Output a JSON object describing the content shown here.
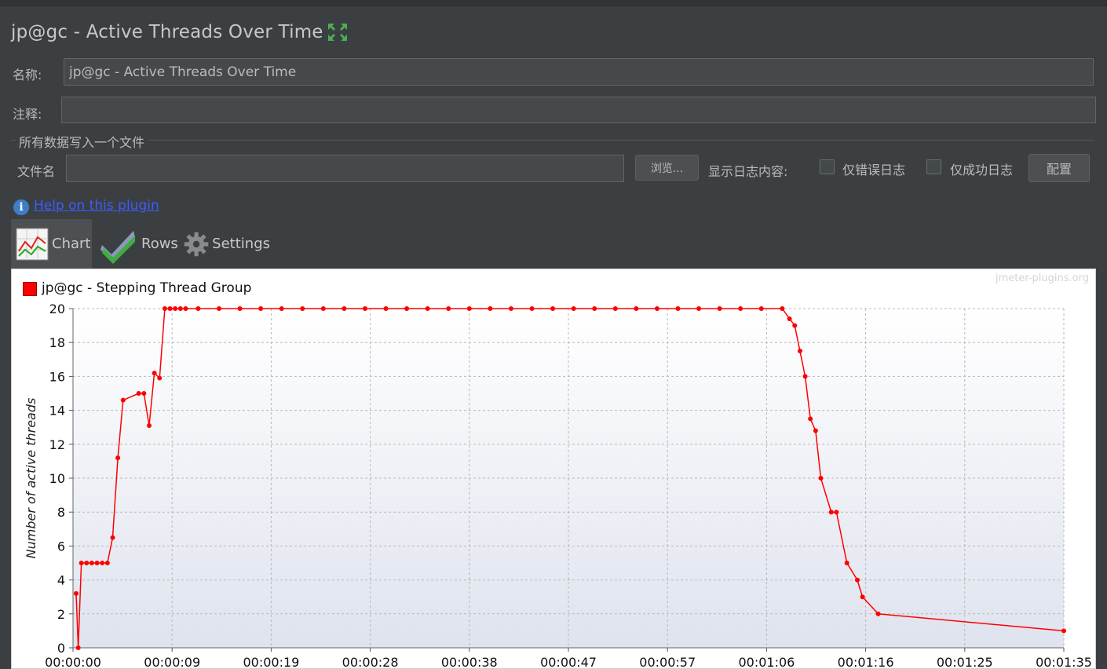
{
  "window": {
    "title": "jp@gc - Active Threads Over Time"
  },
  "form": {
    "name_label": "名称:",
    "name_value": "jp@gc - Active Threads Over Time",
    "comment_label": "注释:",
    "comment_value": "",
    "group_title": "所有数据写入一个文件",
    "filename_label": "文件名",
    "filename_value": "",
    "browse_label": "浏览...",
    "log_display_label": "显示日志内容:",
    "errors_only_label": "仅错误日志",
    "success_only_label": "仅成功日志",
    "configure_label": "配置"
  },
  "help": {
    "link_text": "Help on this plugin"
  },
  "tabs": [
    {
      "label": "Chart",
      "icon": "chart-icon",
      "active": true
    },
    {
      "label": "Rows",
      "icon": "checkmark-icon",
      "active": false
    },
    {
      "label": "Settings",
      "icon": "gear-icon",
      "active": false
    }
  ],
  "chart": {
    "watermark": "jmeter-plugins.org",
    "legend_label": "jp@gc - Stepping Thread Group"
  },
  "chart_data": {
    "type": "line",
    "title": "",
    "xlabel": "",
    "ylabel": "Number of active threads",
    "ylim": [
      0,
      20
    ],
    "y_ticks": [
      0,
      2,
      4,
      6,
      8,
      10,
      12,
      14,
      16,
      18,
      20
    ],
    "x_tick_labels": [
      "00:00:00",
      "00:00:09",
      "00:00:19",
      "00:00:28",
      "00:00:38",
      "00:00:47",
      "00:00:57",
      "00:01:06",
      "00:01:16",
      "00:01:25",
      "00:01:35"
    ],
    "xlim_seconds": [
      0,
      95
    ],
    "grid": true,
    "legend_position": "top-left",
    "series_color": "#ff0000",
    "series": [
      {
        "name": "jp@gc - Stepping Thread Group",
        "points": [
          [
            0.3,
            3.2
          ],
          [
            0.5,
            0
          ],
          [
            0.8,
            5
          ],
          [
            1.3,
            5
          ],
          [
            1.8,
            5
          ],
          [
            2.3,
            5
          ],
          [
            2.8,
            5
          ],
          [
            3.3,
            5
          ],
          [
            3.8,
            6.5
          ],
          [
            4.3,
            11.2
          ],
          [
            4.8,
            14.6
          ],
          [
            6.3,
            15
          ],
          [
            6.8,
            15
          ],
          [
            7.3,
            13.1
          ],
          [
            7.8,
            16.2
          ],
          [
            8.3,
            15.9
          ],
          [
            8.8,
            20
          ],
          [
            9.3,
            20
          ],
          [
            9.8,
            20
          ],
          [
            10.3,
            20
          ],
          [
            10.8,
            20
          ],
          [
            12,
            20
          ],
          [
            14,
            20
          ],
          [
            16,
            20
          ],
          [
            18,
            20
          ],
          [
            20,
            20
          ],
          [
            22,
            20
          ],
          [
            24,
            20
          ],
          [
            26,
            20
          ],
          [
            28,
            20
          ],
          [
            30,
            20
          ],
          [
            32,
            20
          ],
          [
            34,
            20
          ],
          [
            36,
            20
          ],
          [
            38,
            20
          ],
          [
            40,
            20
          ],
          [
            42,
            20
          ],
          [
            44,
            20
          ],
          [
            46,
            20
          ],
          [
            48,
            20
          ],
          [
            50,
            20
          ],
          [
            52,
            20
          ],
          [
            54,
            20
          ],
          [
            56,
            20
          ],
          [
            58,
            20
          ],
          [
            60,
            20
          ],
          [
            62,
            20
          ],
          [
            64,
            20
          ],
          [
            66,
            20
          ],
          [
            68,
            20
          ],
          [
            68.7,
            19.4
          ],
          [
            69.2,
            19
          ],
          [
            69.7,
            17.5
          ],
          [
            70.2,
            16
          ],
          [
            70.7,
            13.5
          ],
          [
            71.2,
            12.8
          ],
          [
            71.7,
            10
          ],
          [
            72.7,
            8
          ],
          [
            73.2,
            8
          ],
          [
            74.2,
            5
          ],
          [
            75.2,
            4
          ],
          [
            75.7,
            3
          ],
          [
            77.2,
            2
          ],
          [
            95,
            1
          ]
        ]
      }
    ]
  }
}
